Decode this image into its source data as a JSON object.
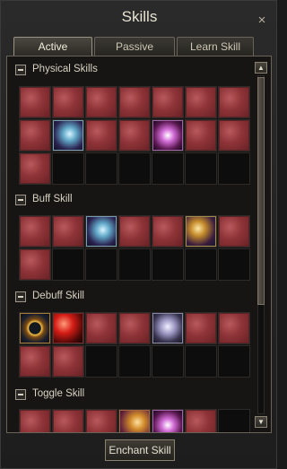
{
  "window": {
    "title": "Skills",
    "close_glyph": "×",
    "close_icon": "close-icon"
  },
  "tabs": [
    {
      "label": "Active",
      "active": true
    },
    {
      "label": "Passive",
      "active": false
    },
    {
      "label": "Learn Skill",
      "active": false
    }
  ],
  "sections": [
    {
      "label": "Physical Skills",
      "expanded": true,
      "slots": 21,
      "icons": [
        "red",
        "red",
        "red",
        "red",
        "red",
        "red",
        "red",
        "red",
        "bright2",
        "red",
        "red",
        "bright3",
        "red",
        "red",
        "red"
      ]
    },
    {
      "label": "Buff Skill",
      "expanded": true,
      "slots": 14,
      "icons": [
        "red",
        "red",
        "bright2",
        "red",
        "red",
        "bright",
        "red",
        "red"
      ]
    },
    {
      "label": "Debuff Skill",
      "expanded": true,
      "slots": 14,
      "icons": [
        "ring",
        "orb",
        "red",
        "red",
        "white",
        "red",
        "red",
        "red",
        "red"
      ]
    },
    {
      "label": "Toggle Skill",
      "expanded": true,
      "slots": 7,
      "icons": [
        "red",
        "red",
        "red",
        "fire",
        "bright3",
        "red"
      ]
    }
  ],
  "scrollbar": {
    "up_glyph": "▲",
    "down_glyph": "▼",
    "visible_fraction": 0.67
  },
  "footer": {
    "enchant_label": "Enchant Skill"
  },
  "colors": {
    "window_bg": "#232220",
    "text": "#d9d2c2",
    "icon_red": "#8f3438"
  }
}
